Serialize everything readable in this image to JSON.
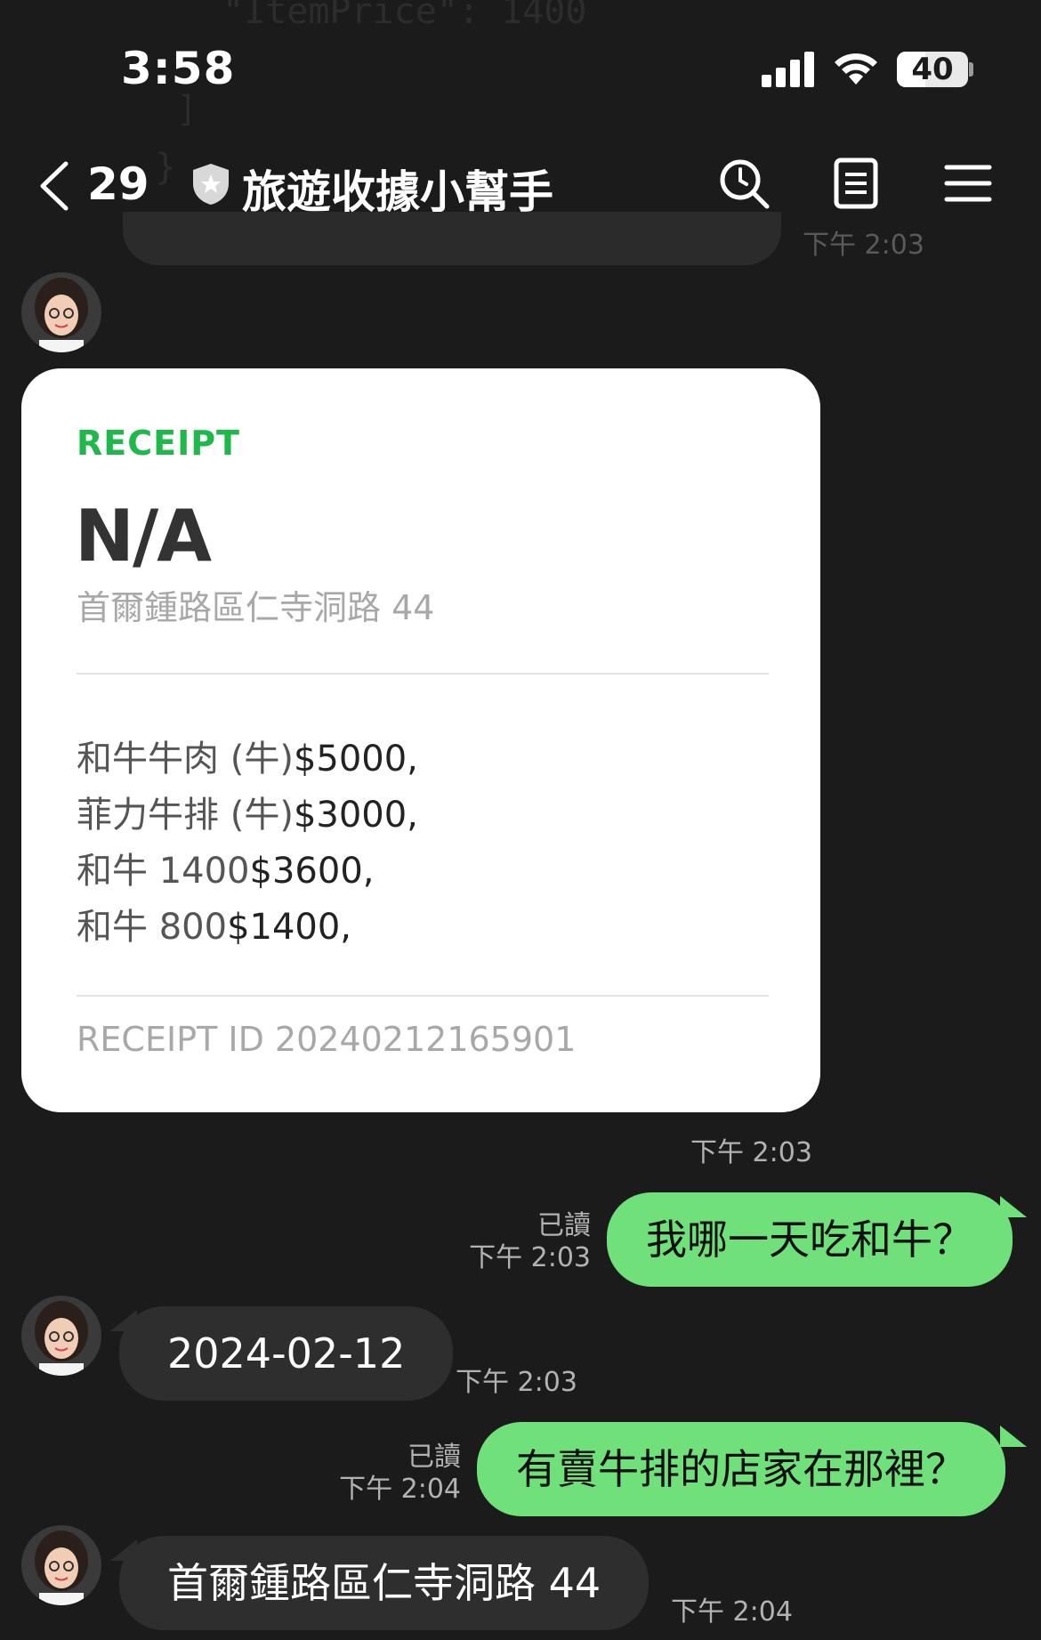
{
  "status_bar": {
    "time": "3:58",
    "battery": "40"
  },
  "header": {
    "unread_count": "29",
    "title": "旅遊收據小幫手"
  },
  "previous": {
    "time": "下午 2:03"
  },
  "receipt": {
    "label": "RECEIPT",
    "store": "N/A",
    "address": "首爾鍾路區仁寺洞路 44",
    "items": [
      {
        "name": "和牛牛肉 (牛)",
        "price": "$5000,"
      },
      {
        "name": "菲力牛排 (牛)",
        "price": "$3000,"
      },
      {
        "name": "和牛 1400",
        "price": "$3600,"
      },
      {
        "name": "和牛 800",
        "price": "$1400,"
      }
    ],
    "receipt_id": "RECEIPT ID 20240212165901",
    "time": "下午 2:03"
  },
  "messages": [
    {
      "text": "我哪一天吃和牛？",
      "read": "已讀",
      "time": "下午 2:03"
    },
    {
      "text": "2024-02-12",
      "time": "下午 2:03"
    },
    {
      "text": "有賣牛排的店家在那裡？",
      "read": "已讀",
      "time": "下午 2:04"
    },
    {
      "text": "首爾鍾路區仁寺洞路 44",
      "time": "下午 2:04"
    }
  ]
}
